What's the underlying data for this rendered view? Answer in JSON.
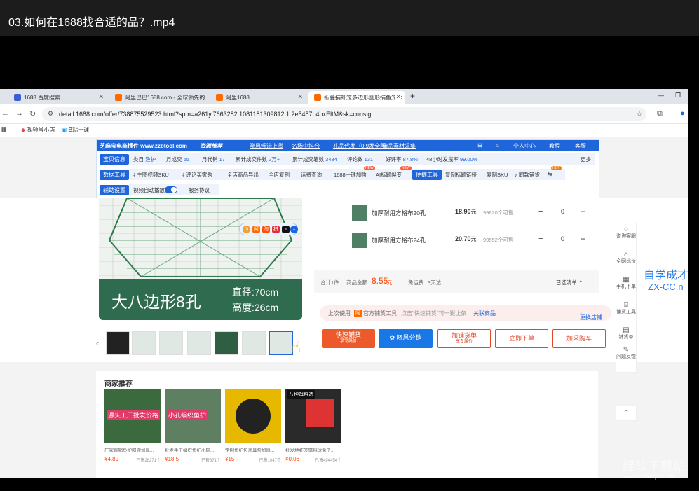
{
  "video": {
    "title": "03.如何在1688找合适的品？.mp4"
  },
  "browser": {
    "tabs": [
      {
        "label": "1688 百度搜索"
      },
      {
        "label": "阿里巴巴1688.com - 全球领先的"
      },
      {
        "label": "阿里1688"
      },
      {
        "label": "折叠捕虾笼多边形圆形捕鱼笼水"
      }
    ],
    "url": "detail.1688.com/offer/738875529523.html?spm=a261y.7663282.1081181309812.1.2e5457b4bxEltM&sk=consign",
    "bookmarks": [
      {
        "label": "视频号小店"
      },
      {
        "label": "B站一课"
      }
    ]
  },
  "plugin": {
    "brand": "芝麻宝电商插件 www.zzbtool.com",
    "topbar": [
      "资源推荐",
      "晓风畅流上货",
      "名场中抖合",
      "礼品代发（0.9发全国）",
      "商品素材采集",
      "个人中心",
      "教程",
      "客服"
    ],
    "info_label": "宝贝信息",
    "info": [
      {
        "k": "类目",
        "v": "渔护"
      },
      {
        "k": "月成交",
        "v": "55"
      },
      {
        "k": "月代销",
        "v": "17"
      },
      {
        "k": "累计成交件数",
        "v": "2万+"
      },
      {
        "k": "累计成交笔数",
        "v": "3484"
      },
      {
        "k": "评论数",
        "v": "131"
      },
      {
        "k": "好评率",
        "v": "87.8%"
      },
      {
        "k": "48小时发揽率",
        "v": "99.00%"
      }
    ],
    "more": "更多",
    "data_label": "数据工具",
    "data_tools": [
      "主图视频SKU",
      "评论买家秀",
      "全店商品导出",
      "全店复制",
      "运费查询",
      "1688一键加购",
      "AI标题裂变"
    ],
    "convenience_label": "便捷工具",
    "convenience_tools": [
      "复制标题链接",
      "复制SKU",
      "同款铺货"
    ],
    "badge_new": "NEW",
    "badge_hot": "HOT",
    "assist_label": "辅助设置",
    "assist": [
      "视频自动播放",
      "服务协议"
    ]
  },
  "product": {
    "banner_text": "大八边形8孔",
    "dim1": "直径:70cm",
    "dim2": "高度:26cm"
  },
  "skus": [
    {
      "name": "加厚耐用方格布20孔",
      "price": "18.90",
      "unit": "元",
      "stock": "99820个可售",
      "qty": "0"
    },
    {
      "name": "加厚耐用方格布24孔",
      "price": "20.70",
      "unit": "元",
      "stock": "99552个可售",
      "qty": "0"
    }
  ],
  "summary": {
    "total_count": "合计1件",
    "amount_label": "商品金额",
    "amount": "8.55",
    "amount_unit": "元",
    "shipping_label": "免运费",
    "delivery": "3天达",
    "selected": "已选清单"
  },
  "hint": {
    "last_used": "上次使用",
    "tool": "官方铺货工具",
    "tip": "点击\"快速铺货\"可一键上架",
    "link": "关联商品",
    "switch_store": "更换店铺"
  },
  "buttons": {
    "quick_list": "快速铺货",
    "quick_list_sub": "享专属价",
    "xiaofeng": "晓风分销",
    "add_list": "加铺货单",
    "add_list_sub": "享专属价",
    "buy_now": "立即下单",
    "add_cart": "加采购车"
  },
  "sidebar": [
    {
      "icon": "chat-icon",
      "label": "咨询客服"
    },
    {
      "icon": "compare-icon",
      "label": "全网比价"
    },
    {
      "icon": "qr-icon",
      "label": "手机下单"
    },
    {
      "icon": "store-icon",
      "label": "铺货工具"
    },
    {
      "icon": "list-icon",
      "label": "铺货单"
    },
    {
      "icon": "feedback-icon",
      "label": "问题反馈"
    }
  ],
  "watermark_side": {
    "line1": "自学成才",
    "line2": "ZX-CC.n"
  },
  "recs": {
    "title": "商家推荐",
    "items": [
      {
        "tag": "源头工厂批发价格",
        "name": "厂家直销鱼护网兜加厚...",
        "price": "¥4.89",
        "sold": "已售28271个"
      },
      {
        "tag": "小孔编织鱼护",
        "name": "批发手工编织鱼护小网...",
        "price": "¥18.5",
        "sold": "已售371个"
      },
      {
        "tag": "",
        "name": "定制鱼护包渔具包加厚...",
        "price": "¥15",
        "sold": "已售1047个"
      },
      {
        "tag": "八种饵料选",
        "name": "批发地虾笼饵料球盒子...",
        "price": "¥0.06",
        "sold": "已售494454个"
      }
    ]
  },
  "watermark_bottom": {
    "line1": "绿软下载站",
    "line2": "www.itmop.com"
  },
  "colors": {
    "accent": "#1e66d9",
    "price": "#ff4400",
    "quick_btn": "#ec5a2c",
    "xiaofeng": "#1a78e6"
  }
}
